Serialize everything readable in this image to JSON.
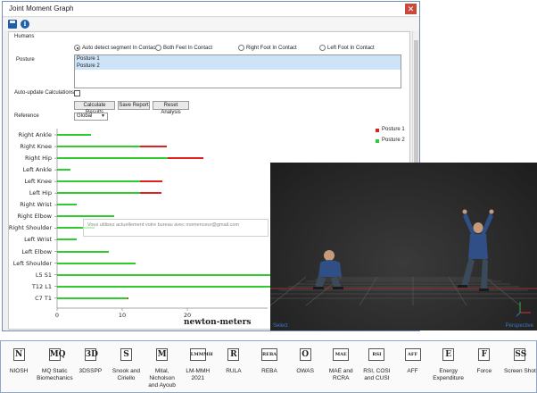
{
  "window": {
    "title": "Joint Moment Graph",
    "close_label": "✕"
  },
  "humans": {
    "section_label": "Humans",
    "posture_label": "Posture",
    "contact_options": [
      {
        "label": "Auto detect segment In Contact",
        "selected": true
      },
      {
        "label": "Both Feet In Contact",
        "selected": false
      },
      {
        "label": "Right Foot In Contact",
        "selected": false
      },
      {
        "label": "Left Foot In Contact",
        "selected": false
      }
    ],
    "postures": [
      "Posture 1",
      "Posture 2"
    ],
    "auto_update_label": "Auto-update Calculations",
    "auto_update_checked": false,
    "buttons": {
      "calculate": "Calculate Results",
      "save": "Save Report",
      "reset": "Reset Analysis"
    },
    "reference_label": "Reference",
    "reference_value": "Global"
  },
  "chart_data": {
    "type": "bar",
    "orientation": "horizontal",
    "categories": [
      "Right Ankle",
      "Right Knee",
      "Right Hip",
      "Left Ankle",
      "Left Knee",
      "Left Hip",
      "Right Wrist",
      "Right Elbow",
      "Right Shoulder",
      "Left Wrist",
      "Left Elbow",
      "Left Shoulder",
      "L5 S1",
      "T12 L1",
      "C7 T1"
    ],
    "series": [
      {
        "name": "Posture 1",
        "color": "#e01f1f",
        "values": [
          0.2,
          16.8,
          22.5,
          0.3,
          16.2,
          16.0,
          0.3,
          0.2,
          0.2,
          0.2,
          0.2,
          0.2,
          60,
          60,
          11.0
        ]
      },
      {
        "name": "Posture 2",
        "color": "#2ecc2e",
        "values": [
          5.2,
          12.8,
          17.0,
          2.0,
          12.8,
          12.8,
          3.0,
          8.8,
          5.8,
          3.0,
          8.0,
          12.0,
          60,
          60,
          10.8
        ]
      }
    ],
    "xlabel": "newton-meters",
    "xticks": [
      0,
      10,
      20
    ],
    "xlim": [
      0,
      60
    ],
    "legend_position": "right"
  },
  "notification": {
    "text": "Vous utilisez actuellement votre bureau avec momenceur@gmail.com"
  },
  "viewport": {
    "left_label": "Select",
    "right_label": "Perspective"
  },
  "toolbar": [
    {
      "icon": "N",
      "label": "NIOSH"
    },
    {
      "icon": "MQ",
      "label": "MQ Static Biomechanics"
    },
    {
      "icon": "3D",
      "label": "3DSSPP"
    },
    {
      "icon": "S",
      "label": "Snook and Ciriello"
    },
    {
      "icon": "M",
      "label": "Mital, Nicholson and Ayoub"
    },
    {
      "icon": "LMMMH",
      "label": "LM-MMH 2021"
    },
    {
      "icon": "R",
      "label": "RULA"
    },
    {
      "icon": "REBA",
      "label": "REBA"
    },
    {
      "icon": "O",
      "label": "OWAS"
    },
    {
      "icon": "MAE",
      "label": "MAE and RCRA"
    },
    {
      "icon": "RSI",
      "label": "RSI, COSI and CUSI"
    },
    {
      "icon": "AFF",
      "label": "AFF"
    },
    {
      "icon": "E",
      "label": "Energy Expenditure"
    },
    {
      "icon": "F",
      "label": "Force"
    },
    {
      "icon": "SS",
      "label": "Screen Shot"
    }
  ]
}
